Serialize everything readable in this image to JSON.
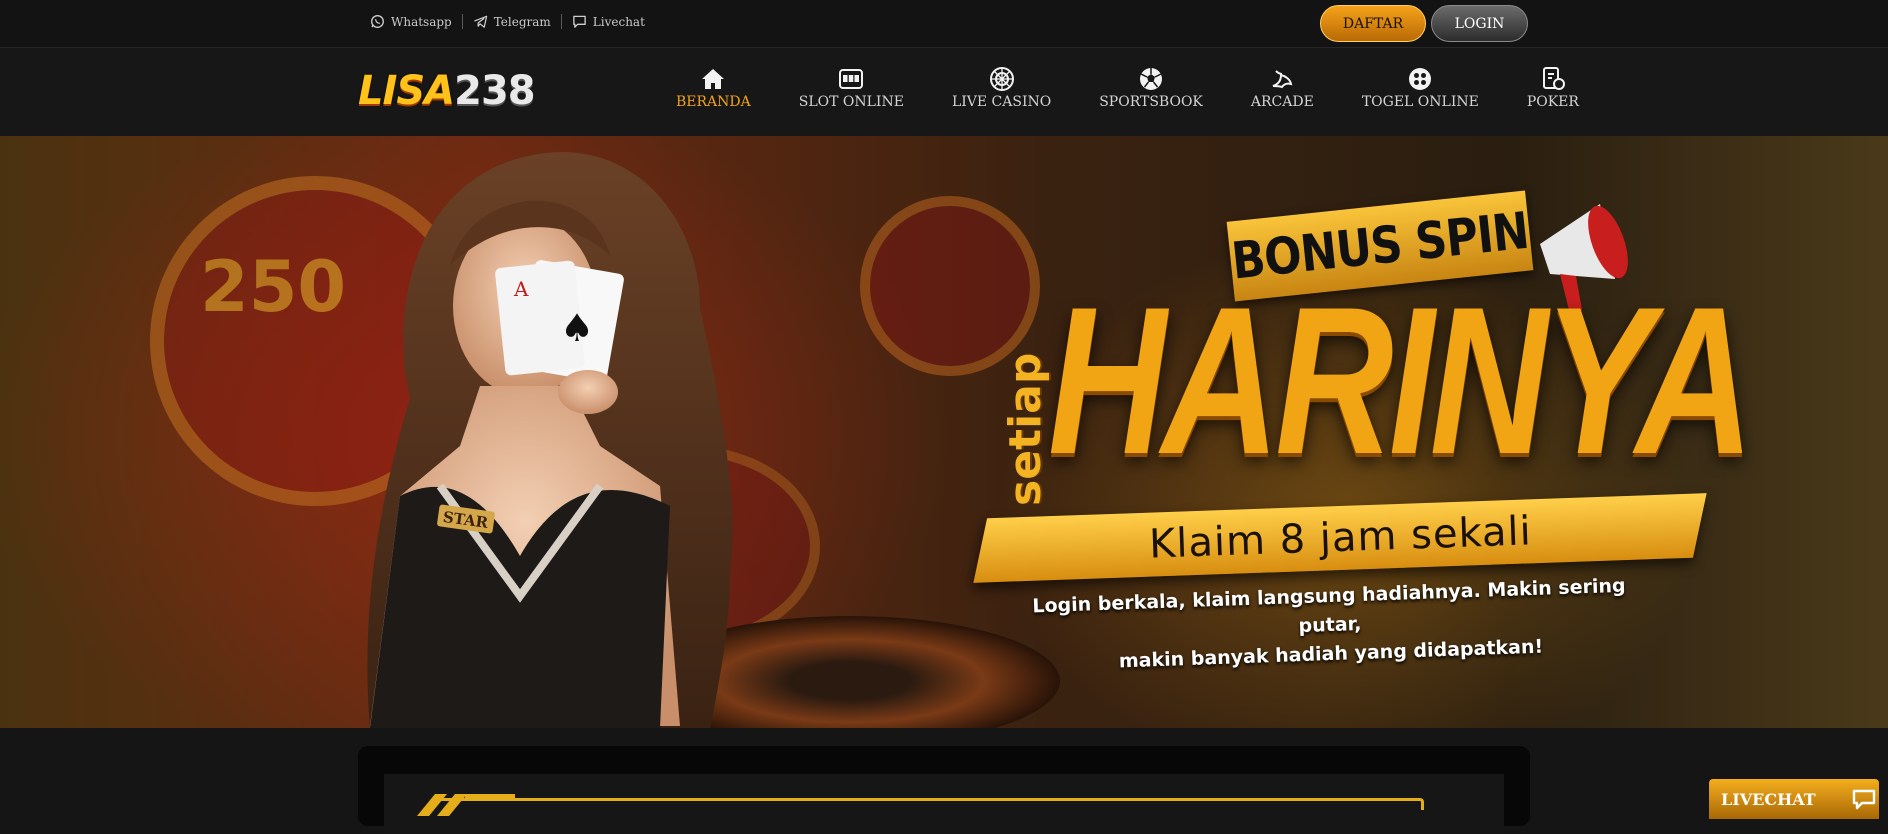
{
  "contacts": [
    {
      "label": "Whatsapp",
      "icon": "whatsapp-icon"
    },
    {
      "label": "Telegram",
      "icon": "telegram-icon"
    },
    {
      "label": "Livechat",
      "icon": "chat-bubble-icon"
    }
  ],
  "auth": {
    "register_label": "DAFTAR",
    "login_label": "LOGIN"
  },
  "logo": {
    "part1": "LISA",
    "part2": "238"
  },
  "nav": [
    {
      "label": "BERANDA",
      "icon": "home-icon",
      "active": true
    },
    {
      "label": "SLOT ONLINE",
      "icon": "slot-machine-icon",
      "active": false
    },
    {
      "label": "LIVE CASINO",
      "icon": "roulette-icon",
      "active": false
    },
    {
      "label": "SPORTSBOOK",
      "icon": "soccer-ball-icon",
      "active": false
    },
    {
      "label": "ARCADE",
      "icon": "fish-icon",
      "active": false
    },
    {
      "label": "TOGEL ONLINE",
      "icon": "lottery-icon",
      "active": false
    },
    {
      "label": "POKER",
      "icon": "poker-card-icon",
      "active": false
    }
  ],
  "banner": {
    "bonus": "BONUS SPIN",
    "setiap": "setiap",
    "headline": "HARINYA",
    "klaim": "Klaim 8 jam sekali",
    "sub_line1": "Login berkala, klaim langsung hadiahnya. Makin sering putar,",
    "sub_line2": "makin banyak hadiah yang didapatkan!",
    "chip_text": "250",
    "badge_text": "STAR"
  },
  "livechat": {
    "label": "LIVECHAT"
  },
  "colors": {
    "accent": "#f5a21a",
    "background": "#151515"
  }
}
